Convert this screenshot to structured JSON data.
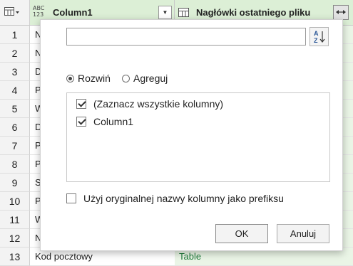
{
  "header": {
    "type_icon_line1": "ABC",
    "type_icon_line2": "123",
    "column1_title": "Column1",
    "column2_title": "Nagłówki ostatniego pliku"
  },
  "rows": [
    {
      "num": "1",
      "col1": "N",
      "col2": ""
    },
    {
      "num": "2",
      "col1": "N",
      "col2": ""
    },
    {
      "num": "3",
      "col1": "D",
      "col2": ""
    },
    {
      "num": "4",
      "col1": "P",
      "col2": ""
    },
    {
      "num": "5",
      "col1": "W",
      "col2": ""
    },
    {
      "num": "6",
      "col1": "D",
      "col2": ""
    },
    {
      "num": "7",
      "col1": "P",
      "col2": ""
    },
    {
      "num": "8",
      "col1": "P",
      "col2": ""
    },
    {
      "num": "9",
      "col1": "S",
      "col2": ""
    },
    {
      "num": "10",
      "col1": "P",
      "col2": ""
    },
    {
      "num": "11",
      "col1": "W",
      "col2": ""
    },
    {
      "num": "12",
      "col1": "N",
      "col2": ""
    },
    {
      "num": "13",
      "col1": "Kod pocztowy",
      "col2": "Table"
    }
  ],
  "dialog": {
    "search_value": "",
    "mode_expand_label": "Rozwiń",
    "mode_aggregate_label": "Agreguj",
    "select_all_label": "(Zaznacz wszystkie kolumny)",
    "column_option_label": "Column1",
    "prefix_label": "Użyj oryginalnej nazwy kolumny jako prefiksu",
    "ok_label": "OK",
    "cancel_label": "Anuluj"
  },
  "colors": {
    "header_green": "#dcefd6",
    "table_cell_text": "#1e7a3a"
  }
}
